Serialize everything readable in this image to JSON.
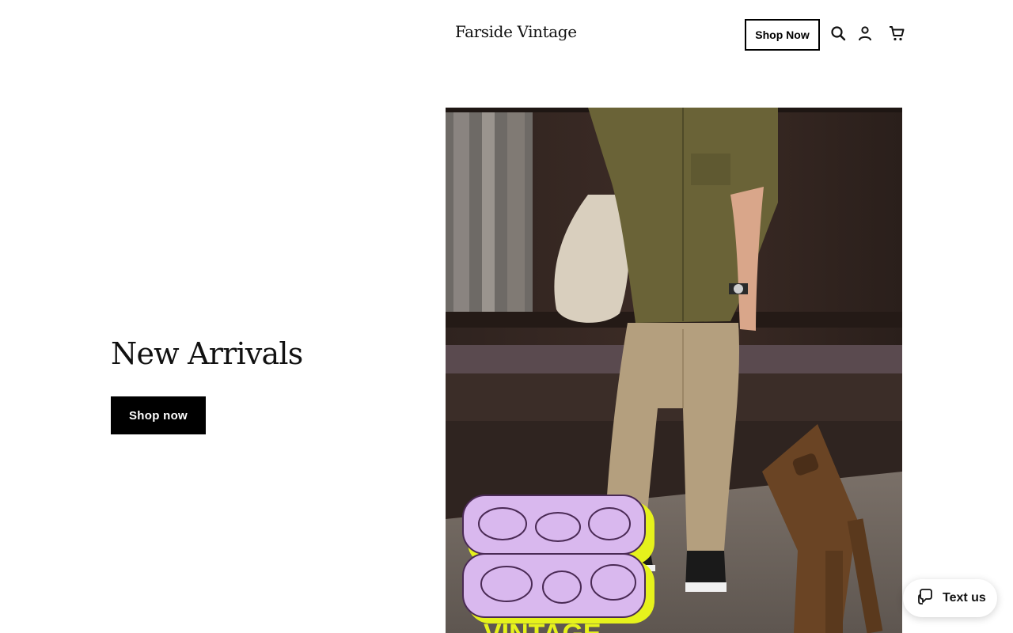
{
  "header": {
    "brand": "Farside Vintage",
    "shop_now_label": "Shop Now",
    "icons": [
      "search-icon",
      "account-icon",
      "cart-icon"
    ]
  },
  "hero": {
    "title": "New Arrivals",
    "cta_label": "Shop now",
    "image_logo_text": "VINTAGE"
  },
  "chat_widget": {
    "label": "Text us",
    "icon": "chat-icon"
  },
  "colors": {
    "button_bg": "#000000",
    "button_text": "#ffffff",
    "background": "#ffffff",
    "logo_fill": "#d9b8ee",
    "logo_shadow": "#e6f21c"
  }
}
